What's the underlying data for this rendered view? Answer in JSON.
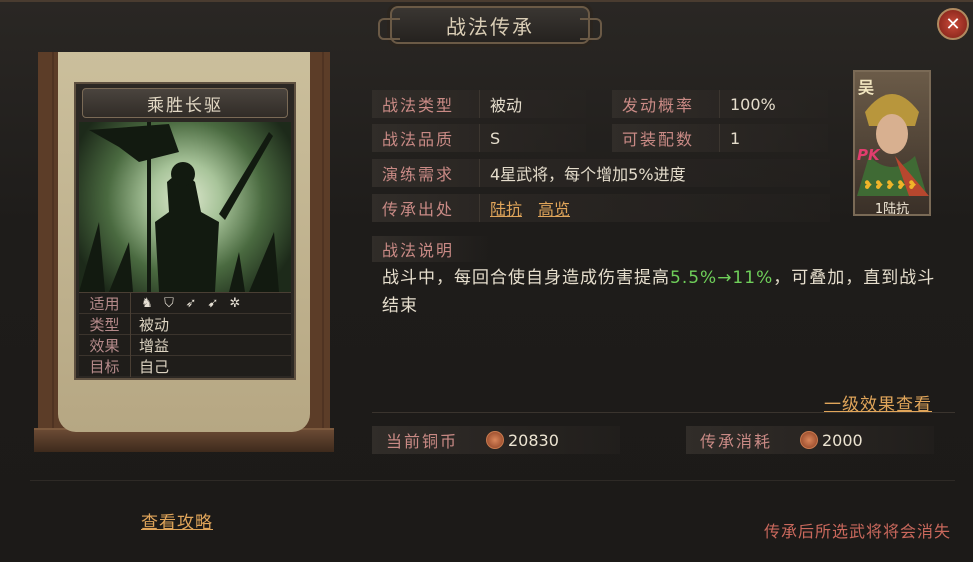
{
  "window": {
    "title": "战法传承",
    "close_icon": "close-icon"
  },
  "skill_card": {
    "name": "乘胜长驱",
    "art_icon": "warrior-banner-silhouette",
    "stats": [
      {
        "key": "适用",
        "value": "",
        "icons": [
          "cavalry-icon",
          "shield-icon",
          "bow-icon",
          "spear-icon",
          "wheel-icon"
        ]
      },
      {
        "key": "类型",
        "value": "被动"
      },
      {
        "key": "效果",
        "value": "增益"
      },
      {
        "key": "目标",
        "value": "自己"
      }
    ]
  },
  "info": {
    "type_label": "战法类型",
    "type_value": "被动",
    "trigger_label": "发动概率",
    "trigger_value": "100%",
    "quality_label": "战法品质",
    "quality_value": "S",
    "equip_label": "可装配数",
    "equip_value": "1",
    "train_label": "演练需求",
    "train_value": "4星武将，每个增加5%进度",
    "source_label": "传承出处",
    "source_links": [
      "陆抗",
      "高览"
    ]
  },
  "description": {
    "title": "战法说明",
    "text_before": "战斗中，每回合使自身造成伤害提高",
    "highlight": "5.5%→11%",
    "text_after": "，可叠加，直到战斗结束"
  },
  "portrait": {
    "faction": "吴",
    "tag": "PK",
    "stars": "❥❥❥❥❥",
    "name": "1陆抗"
  },
  "level_effect_link": "一级效果查看",
  "currency": {
    "current_label": "当前铜币",
    "current_value": "20830",
    "cost_label": "传承消耗",
    "cost_value": "2000",
    "coin_icon": "copper-coin-icon"
  },
  "guide_link": "查看攻略",
  "warning": "传承后所选武将将会消失",
  "colors": {
    "label": "#c98a85",
    "link": "#e0a55a",
    "highlight": "#6fcf5a",
    "warning": "#c9685c"
  }
}
